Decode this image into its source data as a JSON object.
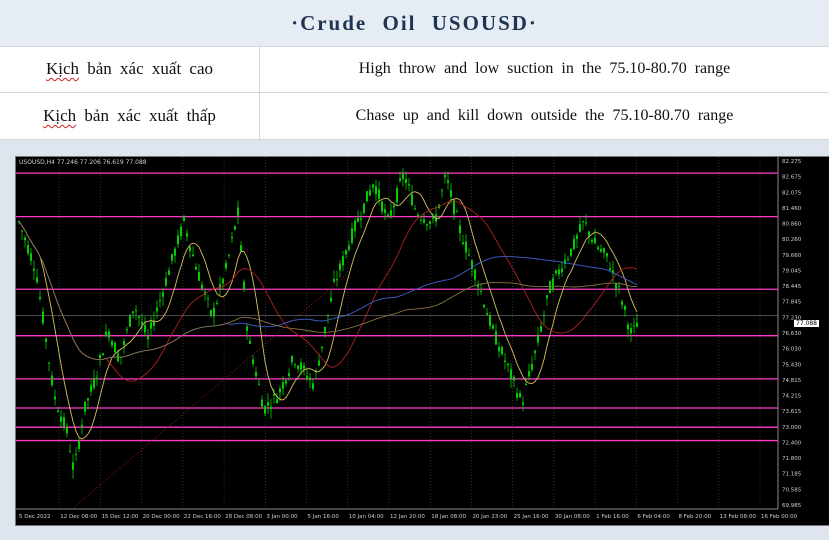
{
  "title": "·Crude Oil USOUSD·",
  "scenarios": [
    {
      "label_parts": [
        "Kịch",
        " bản xác xuất cao"
      ],
      "text": "High throw and low suction in the 75.10-80.70 range"
    },
    {
      "label_parts": [
        "Kịch",
        " bản xác xuất thấp"
      ],
      "text": "Chase up and kill down outside the 75.10-80.70 range"
    }
  ],
  "chart": {
    "symbol_label": "USOUSD,H4  77.246 77.206 76.619 77.088",
    "current_price": "77.088",
    "colors": {
      "candle": "#00d000",
      "level": "#ff3cc8",
      "ma_fast": "#d8c060",
      "ma_mid": "#b02020",
      "ma_slow": "#4060d0",
      "ma_long": "#8a7040"
    }
  },
  "chart_data": {
    "type": "line",
    "title": "",
    "y_ticks": [
      "82.275",
      "82.675",
      "82.075",
      "81.460",
      "80.860",
      "80.260",
      "79.660",
      "79.045",
      "78.445",
      "77.845",
      "77.230",
      "76.630",
      "76.030",
      "75.430",
      "74.815",
      "74.215",
      "73.615",
      "73.000",
      "72.400",
      "71.800",
      "71.185",
      "70.585",
      "69.985"
    ],
    "x_ticks": [
      "5 Dec 2022",
      "12 Dec 08:00",
      "15 Dec 12:00",
      "20 Dec 00:00",
      "22 Dec 16:00",
      "28 Dec 08:00",
      "3 Jan 00:00",
      "5 Jan 16:00",
      "10 Jan 04:00",
      "12 Jan 20:00",
      "18 Jan 08:00",
      "20 Jan 23:00",
      "25 Jan 16:00",
      "30 Jan 08:00",
      "1 Feb 16:00",
      "6 Feb 04:00",
      "8 Feb 20:00",
      "13 Feb 08:00",
      "16 Feb 00:00"
    ],
    "levels": [
      82.42,
      80.79,
      78.07,
      76.33,
      74.71,
      73.62,
      72.9,
      72.4
    ],
    "ylim": [
      69.985,
      82.875
    ]
  }
}
